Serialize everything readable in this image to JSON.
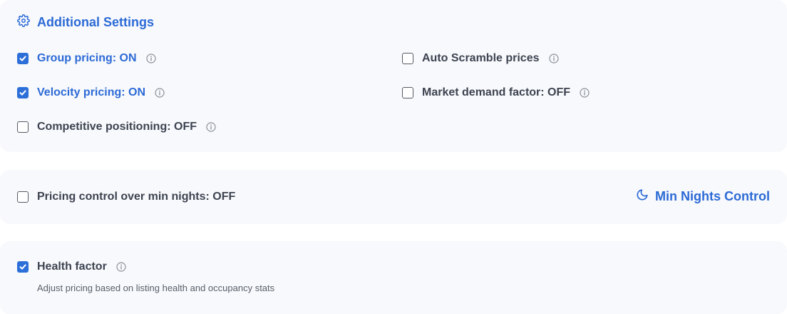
{
  "additional_settings": {
    "title": "Additional Settings",
    "title_icon": "gear-icon"
  },
  "options": {
    "group_pricing": {
      "label": "Group pricing: ON",
      "checked": true
    },
    "velocity_pricing": {
      "label": "Velocity pricing: ON",
      "checked": true
    },
    "competitive_positioning": {
      "label": "Competitive positioning: OFF",
      "checked": false
    },
    "auto_scramble": {
      "label": "Auto Scramble prices",
      "checked": false
    },
    "market_demand": {
      "label": "Market demand factor: OFF",
      "checked": false
    }
  },
  "min_nights": {
    "label": "Pricing control over min nights: OFF",
    "checked": false,
    "control_label": "Min Nights Control",
    "control_icon": "moon-icon"
  },
  "health_factor": {
    "label": "Health factor",
    "checked": true,
    "description": "Adjust pricing based on listing health and occupancy stats"
  },
  "colors": {
    "accent": "#2c6ad6",
    "checkbox_checked": "#2d6fd8",
    "panel_bg": "#f7f9fc",
    "text": "#3d4350"
  }
}
